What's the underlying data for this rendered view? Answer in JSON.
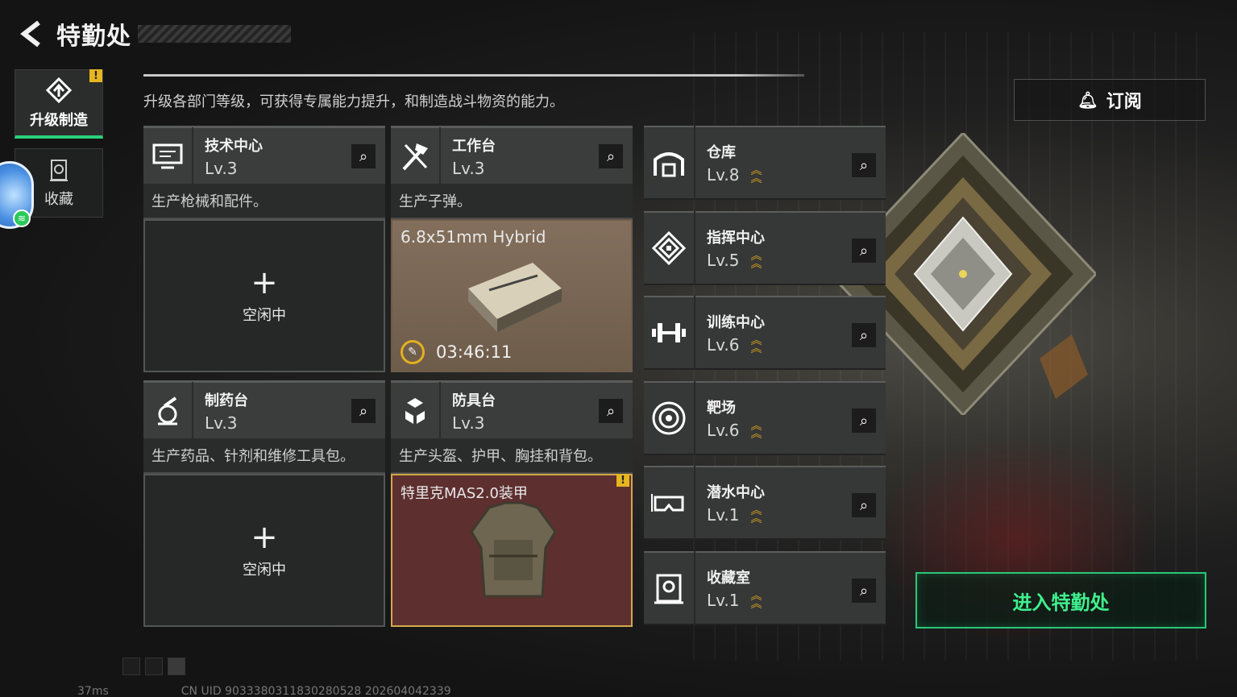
{
  "header": {
    "title": "特勤处",
    "back_icon": "back-arrow-icon"
  },
  "sidebar": {
    "tabs": [
      {
        "label": "升级制造",
        "icon": "upgrade-craft-icon",
        "active": true,
        "alert": "!"
      },
      {
        "label": "收藏",
        "icon": "collection-icon",
        "active": false
      }
    ]
  },
  "description": "升级各部门等级，可获得专属能力提升，和制造战斗物资的能力。",
  "stations": [
    {
      "name": "技术中心",
      "level": "Lv.3",
      "desc": "生产枪械和配件。",
      "state": "idle",
      "idle_label": "空闲中",
      "icon": "tech-center-icon"
    },
    {
      "name": "工作台",
      "level": "Lv.3",
      "desc": "生产子弹。",
      "state": "producing",
      "item": "6.8x51mm Hybrid",
      "timer": "03:46:11",
      "icon": "workbench-icon"
    },
    {
      "name": "制药台",
      "level": "Lv.3",
      "desc": "生产药品、针剂和维修工具包。",
      "state": "idle",
      "idle_label": "空闲中",
      "icon": "pharmacy-icon"
    },
    {
      "name": "防具台",
      "level": "Lv.3",
      "desc": "生产头盔、护甲、胸挂和背包。",
      "state": "done",
      "item": "特里克MAS2.0装甲",
      "alert": "!",
      "icon": "armor-bench-icon"
    }
  ],
  "departments": [
    {
      "name": "仓库",
      "level": "Lv.8",
      "icon": "warehouse-icon"
    },
    {
      "name": "指挥中心",
      "level": "Lv.5",
      "icon": "command-center-icon"
    },
    {
      "name": "训练中心",
      "level": "Lv.6",
      "icon": "training-center-icon"
    },
    {
      "name": "靶场",
      "level": "Lv.6",
      "icon": "shooting-range-icon"
    },
    {
      "name": "潜水中心",
      "level": "Lv.1",
      "icon": "diving-center-icon"
    },
    {
      "name": "收藏室",
      "level": "Lv.1",
      "icon": "collection-room-icon"
    }
  ],
  "subscribe_label": "订阅",
  "enter_label": "进入特勤处",
  "status": {
    "ping": "37ms",
    "uid": "CN UID 9033380311830280528 202604042339"
  },
  "colors": {
    "accent": "#3ff08e",
    "warning": "#e6b520",
    "done_bg": "#5e2f2f",
    "producing_bg": "#7d6a58"
  }
}
